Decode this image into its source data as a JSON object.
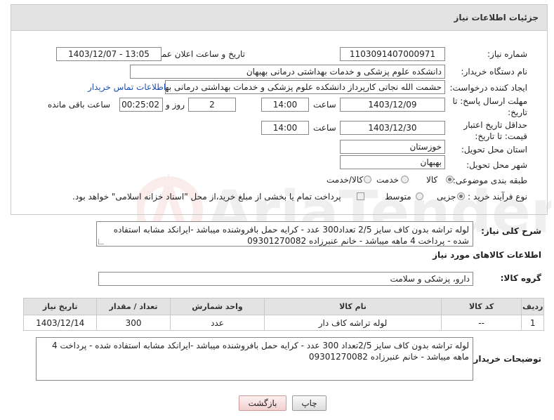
{
  "header": {
    "title": "جزئیات اطلاعات نیاز"
  },
  "fields": {
    "need_number_label": "شماره نیاز:",
    "need_number": "1103091407000971",
    "announce_label": "تاریخ و ساعت اعلان عمومی:",
    "announce_value": "1403/12/07 - 13:05",
    "buyer_org_label": "نام دستگاه خریدار:",
    "buyer_org": "دانشکده علوم پزشکی و خدمات بهداشتی  درمانی بهبهان",
    "requester_label": "ایجاد کننده درخواست:",
    "requester": "حشمت الله نجاتی کارپرداز دانشکده علوم پزشکی و خدمات بهداشتی  درمانی بهبهان",
    "contact_link": "اطلاعات تماس خریدار",
    "deadline_label": "مهلت ارسال پاسخ: تا تاریخ:",
    "deadline_date": "1403/12/09",
    "time_word": "ساعت",
    "deadline_time": "14:00",
    "days_value": "2",
    "days_word": "روز و",
    "remaining_time": "00:25:02",
    "remaining_word": "ساعت باقی مانده",
    "validity_label": "حداقل تاریخ اعتبار قیمت: تا تاریخ:",
    "validity_date": "1403/12/30",
    "validity_time": "14:00",
    "province_label": "استان محل تحویل:",
    "province": "خوزستان",
    "city_label": "شهر محل تحویل:",
    "city": "بهبهان",
    "category_label": "طبقه بندی موضوعی:",
    "category_options": [
      "کالا",
      "خدمت",
      "کالا/خدمت"
    ],
    "process_label": "نوع فرآیند خرید :",
    "process_options": [
      "جزیی",
      "متوسط"
    ],
    "payment_note": "پرداخت تمام یا بخشی از مبلغ خرید،از محل \"اسناد خزانه اسلامی\" خواهد بود."
  },
  "description": {
    "label": "شرح کلی نیاز:",
    "text": "لوله تراشه بدون کاف سایز 2/5 تعداد300 عدد - کرایه حمل بافروشنده میباشد  -ایرانکد مشابه استفاده شده - پرداخت 4 ماهه میباشد - خانم عنبرزاده 09301270082"
  },
  "goods": {
    "section_title": "اطلاعات کالاهای مورد نیاز",
    "group_label": "گروه کالا:",
    "group_value": "دارو، پزشکی و سلامت",
    "columns": [
      "ردیف",
      "کد کالا",
      "نام کالا",
      "واحد شمارش",
      "تعداد / مقدار",
      "تاریخ نیاز"
    ],
    "rows": [
      {
        "row": "1",
        "code": "--",
        "name": "لوله تراشه کاف دار",
        "unit": "عدد",
        "qty": "300",
        "date": "1403/12/14"
      }
    ]
  },
  "buyer_notes": {
    "label": "توضیحات خریدار:",
    "text": "لوله تراشه بدون کاف سایز 2/5تعداد 300 عدد - کرایه حمل بافروشنده میباشد  -ایرانکد مشابه استفاده شده - پرداخت 4 ماهه میباشد - خانم عنبرزاده 09301270082"
  },
  "buttons": {
    "print": "چاپ",
    "back": "بازگشت"
  },
  "colors": {
    "header_bg": "#e3e3e3",
    "link": "#1a4fb3",
    "watermark": "#c0392b"
  }
}
